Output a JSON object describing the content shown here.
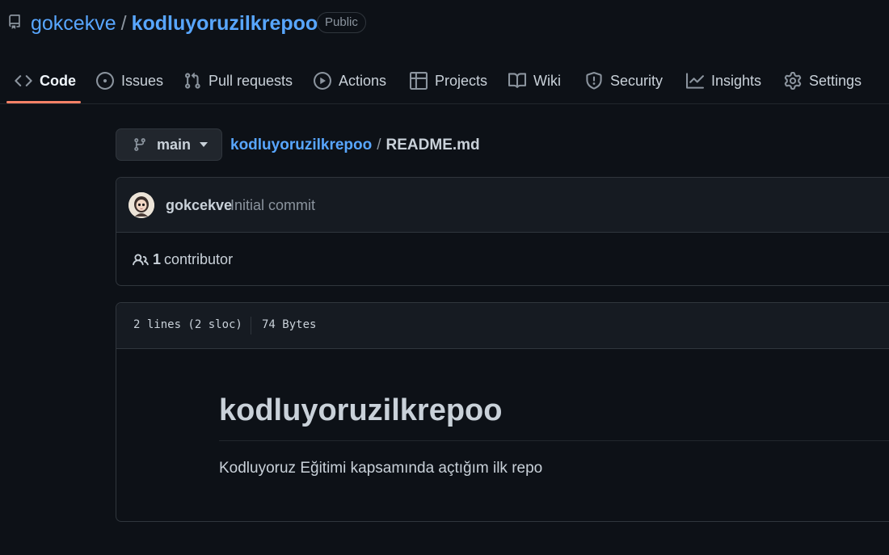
{
  "repo": {
    "owner": "gokcekve",
    "separator": "/",
    "name": "kodluyoruzilkrepoo",
    "visibility": "Public"
  },
  "tabs": [
    {
      "label": "Code",
      "icon": "code-icon",
      "active": true
    },
    {
      "label": "Issues",
      "icon": "issue-opened-icon"
    },
    {
      "label": "Pull requests",
      "icon": "git-pull-request-icon"
    },
    {
      "label": "Actions",
      "icon": "play-icon"
    },
    {
      "label": "Projects",
      "icon": "table-icon"
    },
    {
      "label": "Wiki",
      "icon": "book-icon"
    },
    {
      "label": "Security",
      "icon": "shield-icon"
    },
    {
      "label": "Insights",
      "icon": "graph-icon"
    },
    {
      "label": "Settings",
      "icon": "gear-icon"
    }
  ],
  "path": {
    "branch": "main",
    "repo_link": "kodluyoruzilkrepoo",
    "separator": "/",
    "file": "README.md"
  },
  "commit": {
    "author": "gokcekve",
    "message": "Initial commit"
  },
  "contributors": {
    "count": "1",
    "label": "contributor"
  },
  "file_info": {
    "lines": "2 lines (2 sloc)",
    "size": "74 Bytes"
  },
  "readme": {
    "heading": "kodluyoruzilkrepoo",
    "body": "Kodluyoruz Eğitimi kapsamında açtığım ilk repo"
  },
  "colors": {
    "background": "#0d1117",
    "link": "#58a6ff",
    "active_tab_underline": "#f78166",
    "border": "#30363d"
  }
}
